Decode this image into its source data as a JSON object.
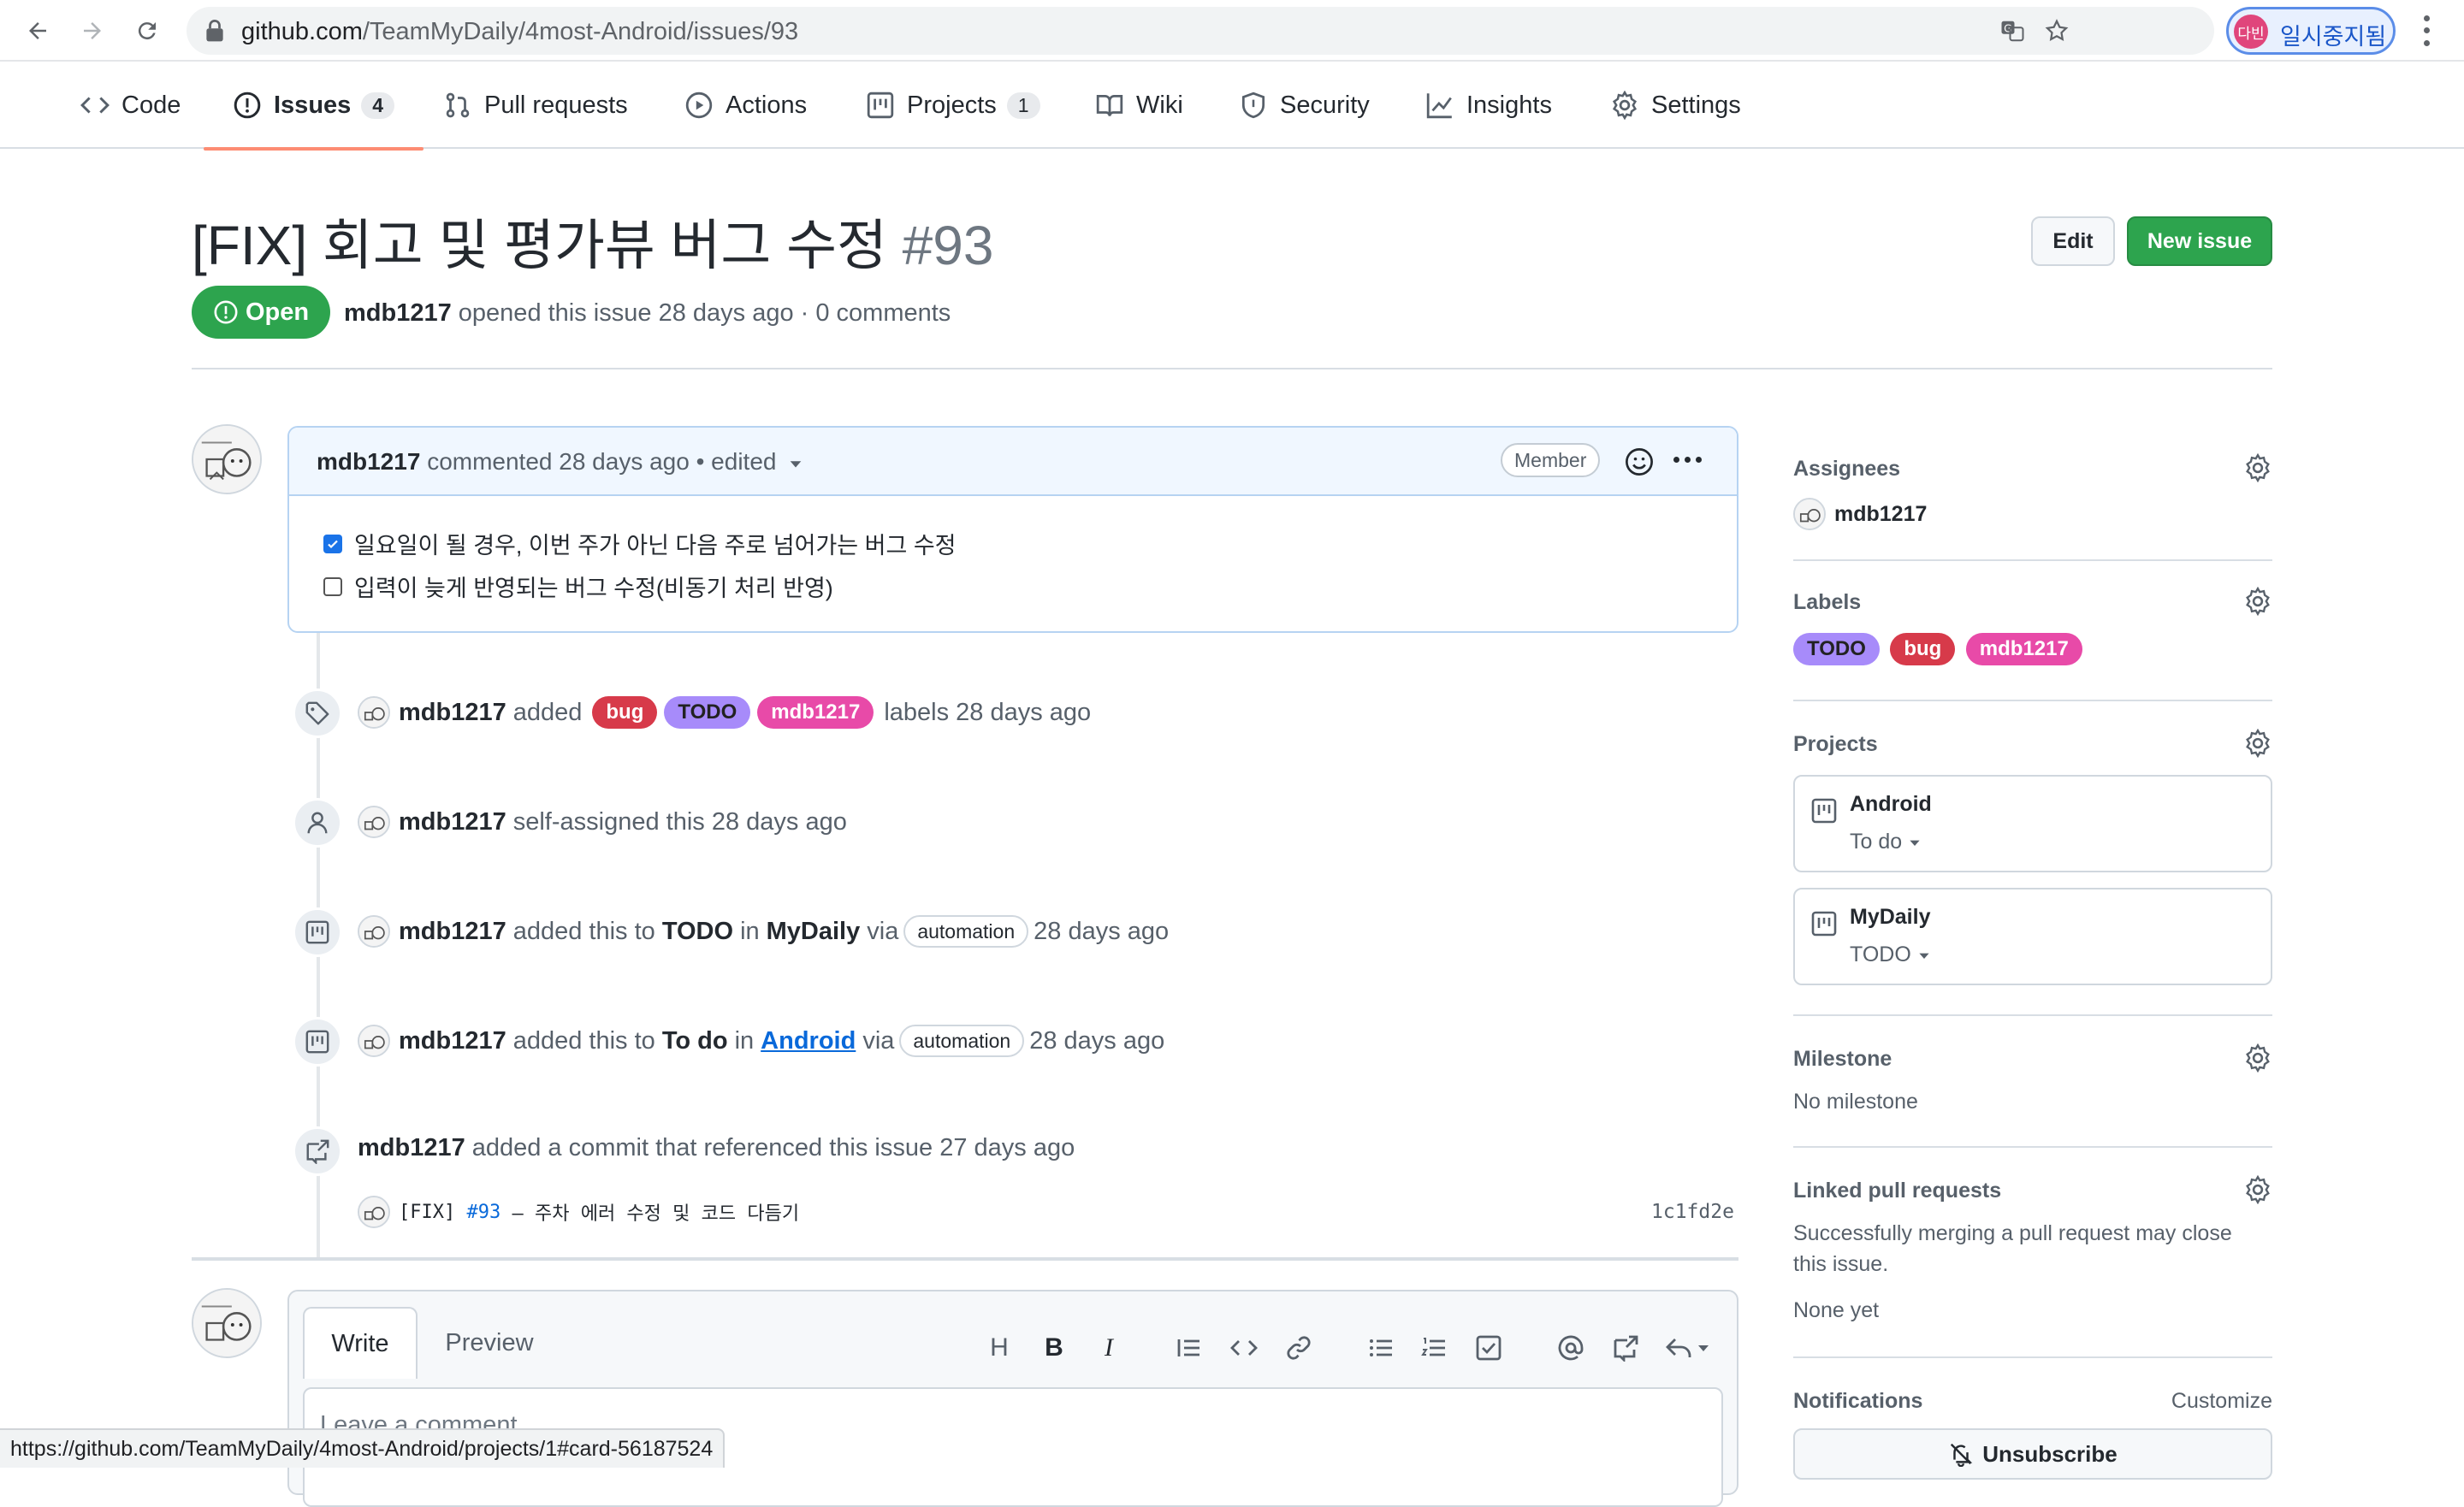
{
  "browser": {
    "url_host": "github.com",
    "url_path": "/TeamMyDaily/4most-Android/issues/93",
    "profile_initial": "다빈",
    "profile_label": "일시중지됨",
    "status_url": "https://github.com/TeamMyDaily/4most-Android/projects/1#card-56187524"
  },
  "repo_tabs": [
    {
      "label": "Code",
      "icon": "code-icon"
    },
    {
      "label": "Issues",
      "icon": "issue-opened-icon",
      "count": "4"
    },
    {
      "label": "Pull requests",
      "icon": "git-pull-request-icon"
    },
    {
      "label": "Actions",
      "icon": "play-icon"
    },
    {
      "label": "Projects",
      "icon": "project-icon",
      "count": "1"
    },
    {
      "label": "Wiki",
      "icon": "book-icon"
    },
    {
      "label": "Security",
      "icon": "shield-icon"
    },
    {
      "label": "Insights",
      "icon": "graph-icon"
    },
    {
      "label": "Settings",
      "icon": "gear-icon"
    }
  ],
  "issue": {
    "title": "[FIX] 회고 및 평가뷰 버그 수정",
    "number": "#93",
    "state": "Open",
    "author": "mdb1217",
    "meta": "opened this issue 28 days ago · 0 comments",
    "edit_label": "Edit",
    "new_issue_label": "New issue"
  },
  "comment": {
    "author": "mdb1217",
    "meta": "commented 28 days ago • edited",
    "role": "Member",
    "tasks": [
      {
        "text": "일요일이 될 경우, 이번 주가 아닌 다음 주로 넘어가는 버그 수정",
        "checked": true
      },
      {
        "text": "입력이 늦게 반영되는 버그 수정(비동기 처리 반영)",
        "checked": false
      }
    ]
  },
  "timeline": {
    "labels_event": {
      "actor": "mdb1217",
      "verb": "added",
      "labels": [
        "bug",
        "TODO",
        "mdb1217"
      ],
      "suffix": "labels 28 days ago"
    },
    "assign_event": {
      "actor": "mdb1217",
      "text": "self-assigned this 28 days ago"
    },
    "project_event_1": {
      "actor": "mdb1217",
      "pre": "added this to",
      "column": "TODO",
      "in": "in",
      "project": "MyDaily",
      "via": "via",
      "badge": "automation",
      "when": "28 days ago"
    },
    "project_event_2": {
      "actor": "mdb1217",
      "pre": "added this to",
      "column": "To do",
      "in": "in",
      "project": "Android",
      "via": "via",
      "badge": "automation",
      "when": "28 days ago"
    },
    "commit_event": {
      "actor": "mdb1217",
      "text": "added a commit that referenced this issue 27 days ago"
    },
    "commit": {
      "prefix": "[FIX]",
      "ref": "#93",
      "message": "– 주차 에러 수정 및 코드 다듬기",
      "sha": "1c1fd2e"
    }
  },
  "composer": {
    "write_tab": "Write",
    "preview_tab": "Preview",
    "placeholder": "Leave a comment",
    "toolbar": {
      "heading": "H",
      "bold": "B",
      "italic": "I"
    }
  },
  "sidebar": {
    "assignees": {
      "heading": "Assignees",
      "user": "mdb1217"
    },
    "labels": {
      "heading": "Labels",
      "items": [
        "TODO",
        "bug",
        "mdb1217"
      ]
    },
    "projects": {
      "heading": "Projects",
      "items": [
        {
          "name": "Android",
          "column": "To do"
        },
        {
          "name": "MyDaily",
          "column": "TODO"
        }
      ]
    },
    "milestone": {
      "heading": "Milestone",
      "value": "No milestone"
    },
    "linked_prs": {
      "heading": "Linked pull requests",
      "desc_1": "Successfully merging a pull request may close",
      "desc_2": "this issue.",
      "value": "None yet"
    },
    "notifications": {
      "heading": "Notifications",
      "customize": "Customize",
      "unsubscribe": "Unsubscribe"
    }
  },
  "colors": {
    "open_green": "#2da44e",
    "label_bug": "#d73a4a",
    "label_todo": "#a78bfa",
    "label_mdb1217": "#e84aa8",
    "link_blue": "#0969da",
    "active_tab_underline": "#fd8c73"
  }
}
